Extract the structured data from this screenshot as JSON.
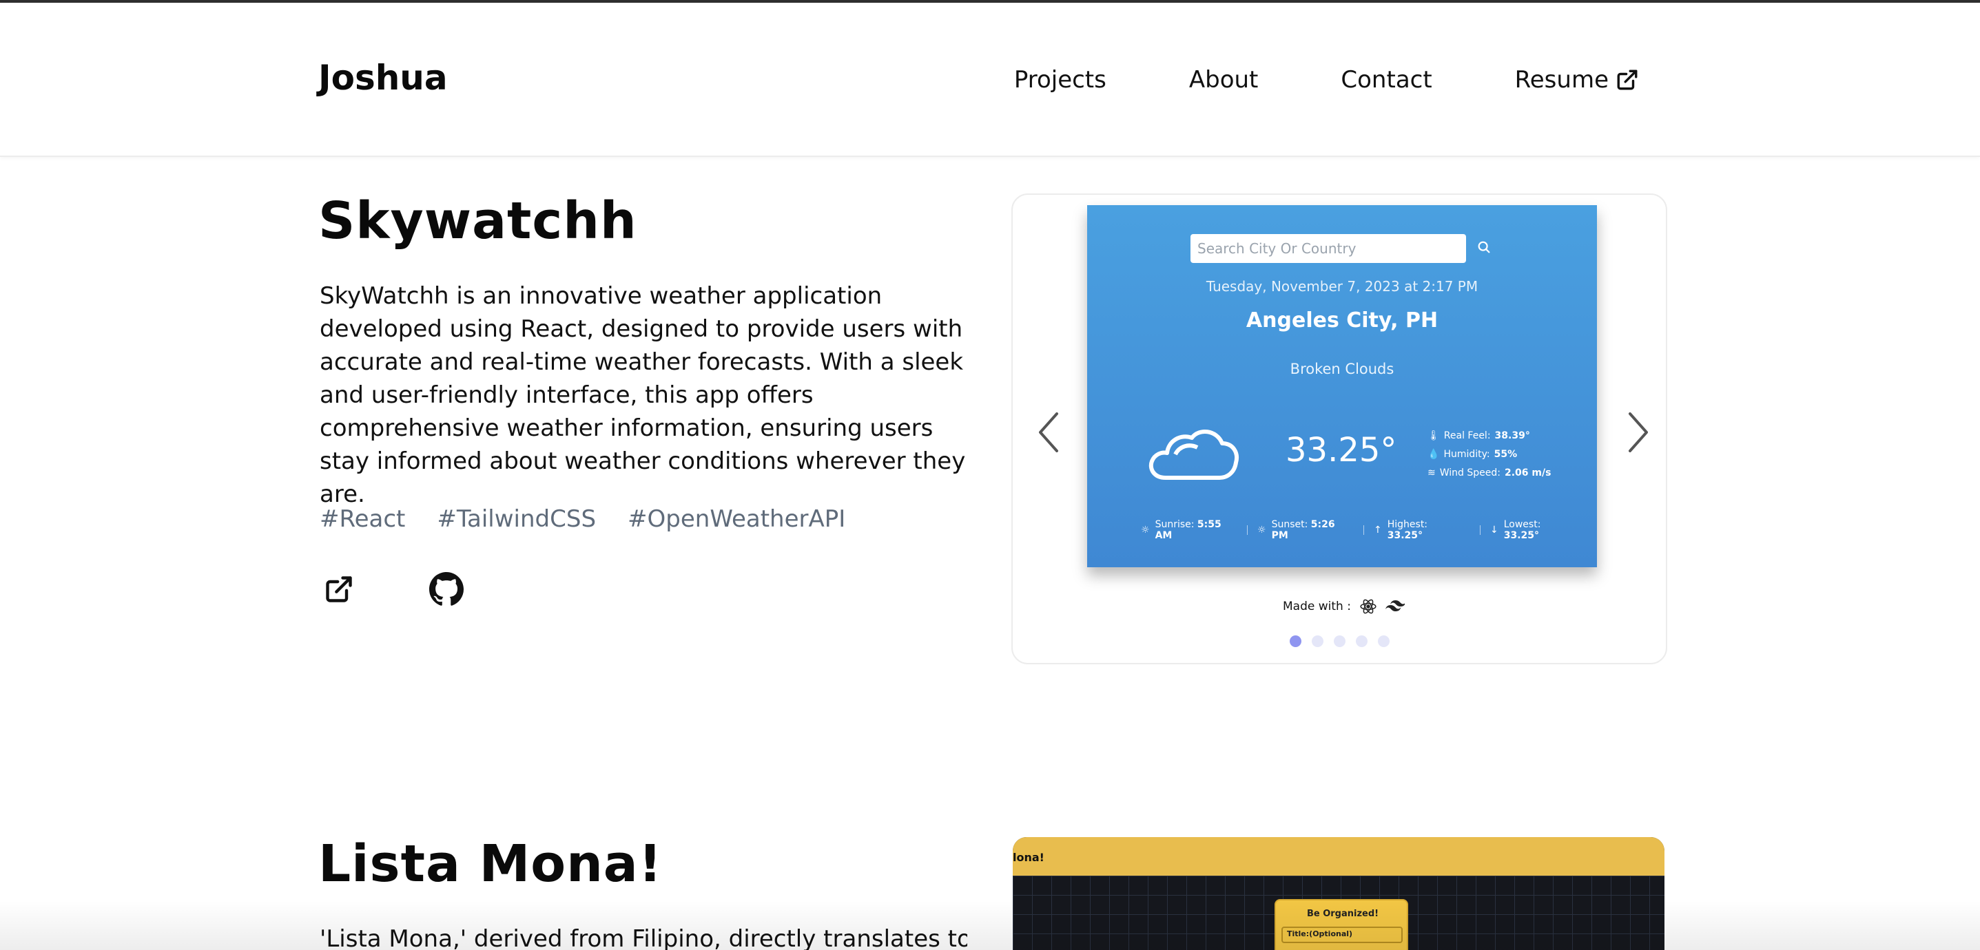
{
  "header": {
    "logo": "Joshua",
    "nav": [
      {
        "label": "Projects"
      },
      {
        "label": "About"
      },
      {
        "label": "Contact"
      },
      {
        "label": "Resume",
        "icon": "external-link-icon"
      }
    ]
  },
  "projects": [
    {
      "title": "Skywatchh",
      "description": "SkyWatchh is an innovative weather application developed using React, designed to provide users with accurate and real-time weather forecasts. With a sleek and user-friendly interface, this app offers comprehensive weather information, ensuring users stay informed about weather conditions wherever they are.",
      "tags": [
        "#React",
        "#TailwindCSS",
        "#OpenWeatherAPI"
      ],
      "links": [
        {
          "icon": "external-link-icon"
        },
        {
          "icon": "github-icon"
        }
      ],
      "preview": {
        "search_placeholder": "Search City Or Country",
        "datetime": "Tuesday, November 7, 2023 at 2:17 PM",
        "city": "Angeles City, PH",
        "condition": "Broken Clouds",
        "temperature": "33.25°",
        "details": [
          {
            "label": "Real Feel:",
            "value": "38.39°",
            "icon": "thermometer-icon"
          },
          {
            "label": "Humidity:",
            "value": "55%",
            "icon": "droplet-icon"
          },
          {
            "label": "Wind Speed:",
            "value": "2.06 m/s",
            "icon": "wind-icon"
          }
        ],
        "bottom": [
          {
            "label": "Sunrise:",
            "value": "5:55",
            "suffix": "AM",
            "icon": "sun-icon"
          },
          {
            "label": "Sunset:",
            "value": "5:26",
            "suffix": "PM",
            "icon": "sun-icon"
          },
          {
            "label": "Highest:",
            "value": "33.25°",
            "icon": "arrow-up-icon"
          },
          {
            "label": "Lowest:",
            "value": "33.25°",
            "icon": "arrow-down-icon"
          }
        ]
      },
      "made_with_label": "Made with :",
      "carousel": {
        "total": 5,
        "active": 1
      },
      "colors": {
        "preview_bg": "#4aa0e0",
        "dot_active": "#8f95f0",
        "dot_inactive": "#e4e6f8"
      }
    },
    {
      "title": "Lista Mona!",
      "description": "'Lista Mona,' derived from Filipino, directly translates to 'List",
      "preview": {
        "bar_text": "lona!",
        "panel_title": "Be Organized!",
        "field_label": "Title:(Optional)"
      },
      "colors": {
        "bar": "#e8bd4e",
        "panel": "#f2c644"
      }
    }
  ]
}
